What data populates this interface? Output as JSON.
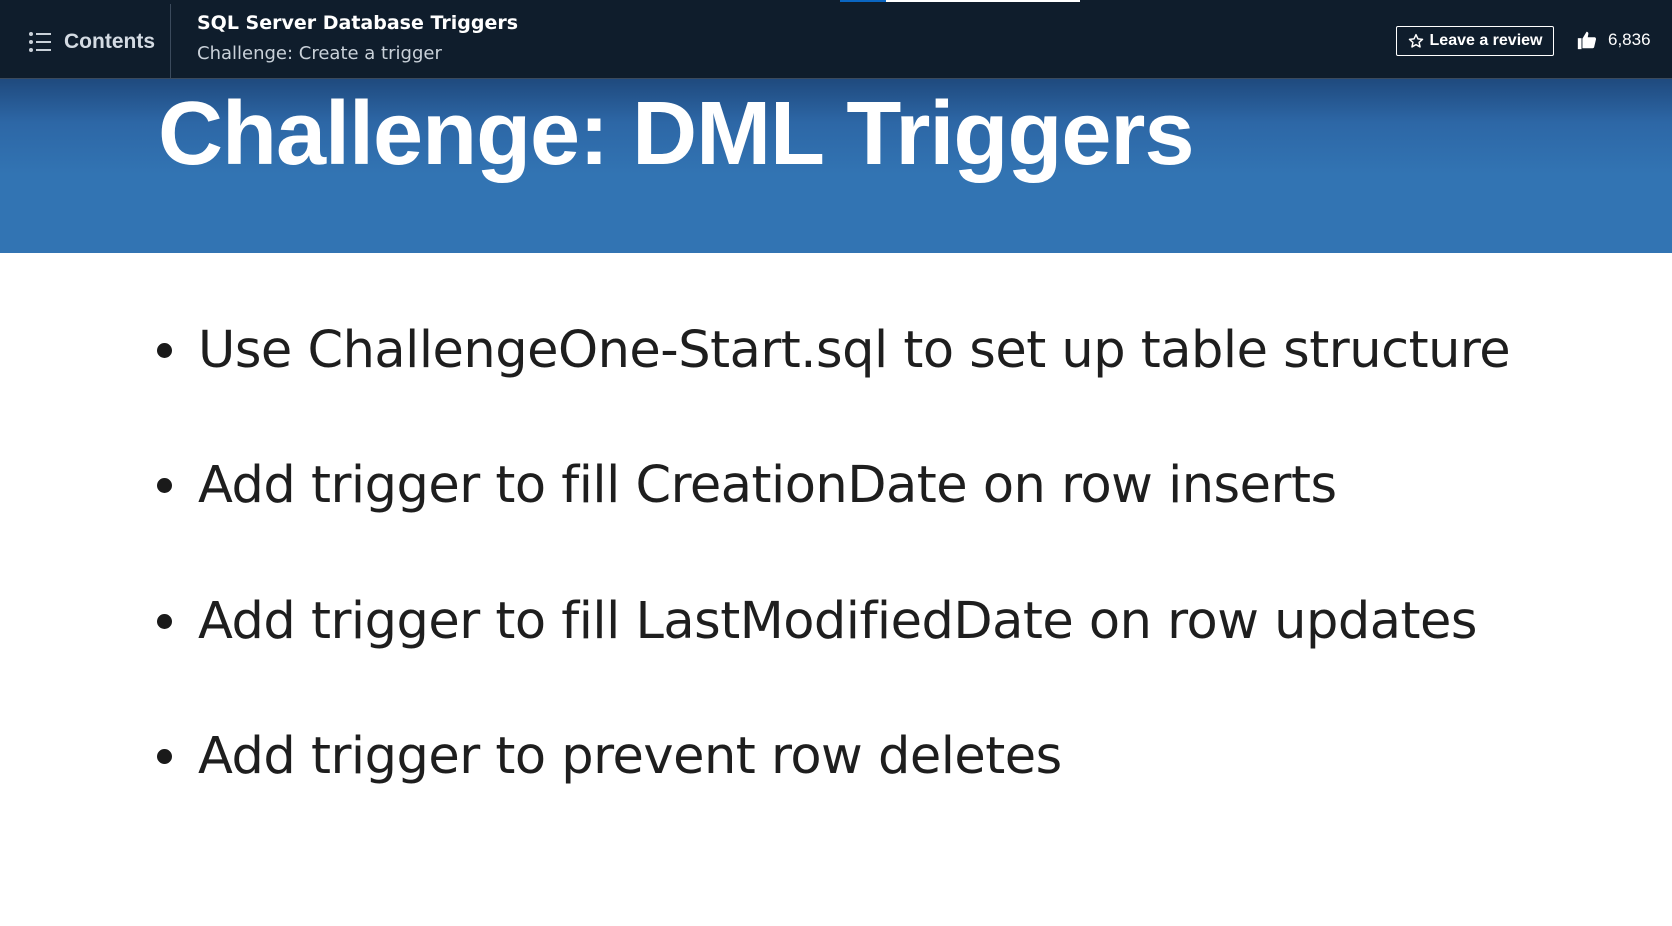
{
  "header": {
    "contents_label": "Contents",
    "course_title": "SQL Server Database Triggers",
    "lesson_title": "Challenge: Create a trigger",
    "review_label": "Leave a review",
    "likes_count": "6,836",
    "progress_percent": 19,
    "accent_color": "#0a66c2"
  },
  "slide": {
    "title": "Challenge: DML Triggers",
    "header_color": "#3274b3",
    "bullets": [
      "Use ChallengeOne-Start.sql to set up table structure",
      "Add trigger to fill CreationDate on row inserts",
      "Add trigger to fill LastModifiedDate on row updates",
      "Add trigger to prevent row deletes"
    ]
  },
  "icons": {
    "contents": "list-icon",
    "review": "star-icon",
    "likes": "thumbs-up-icon"
  }
}
